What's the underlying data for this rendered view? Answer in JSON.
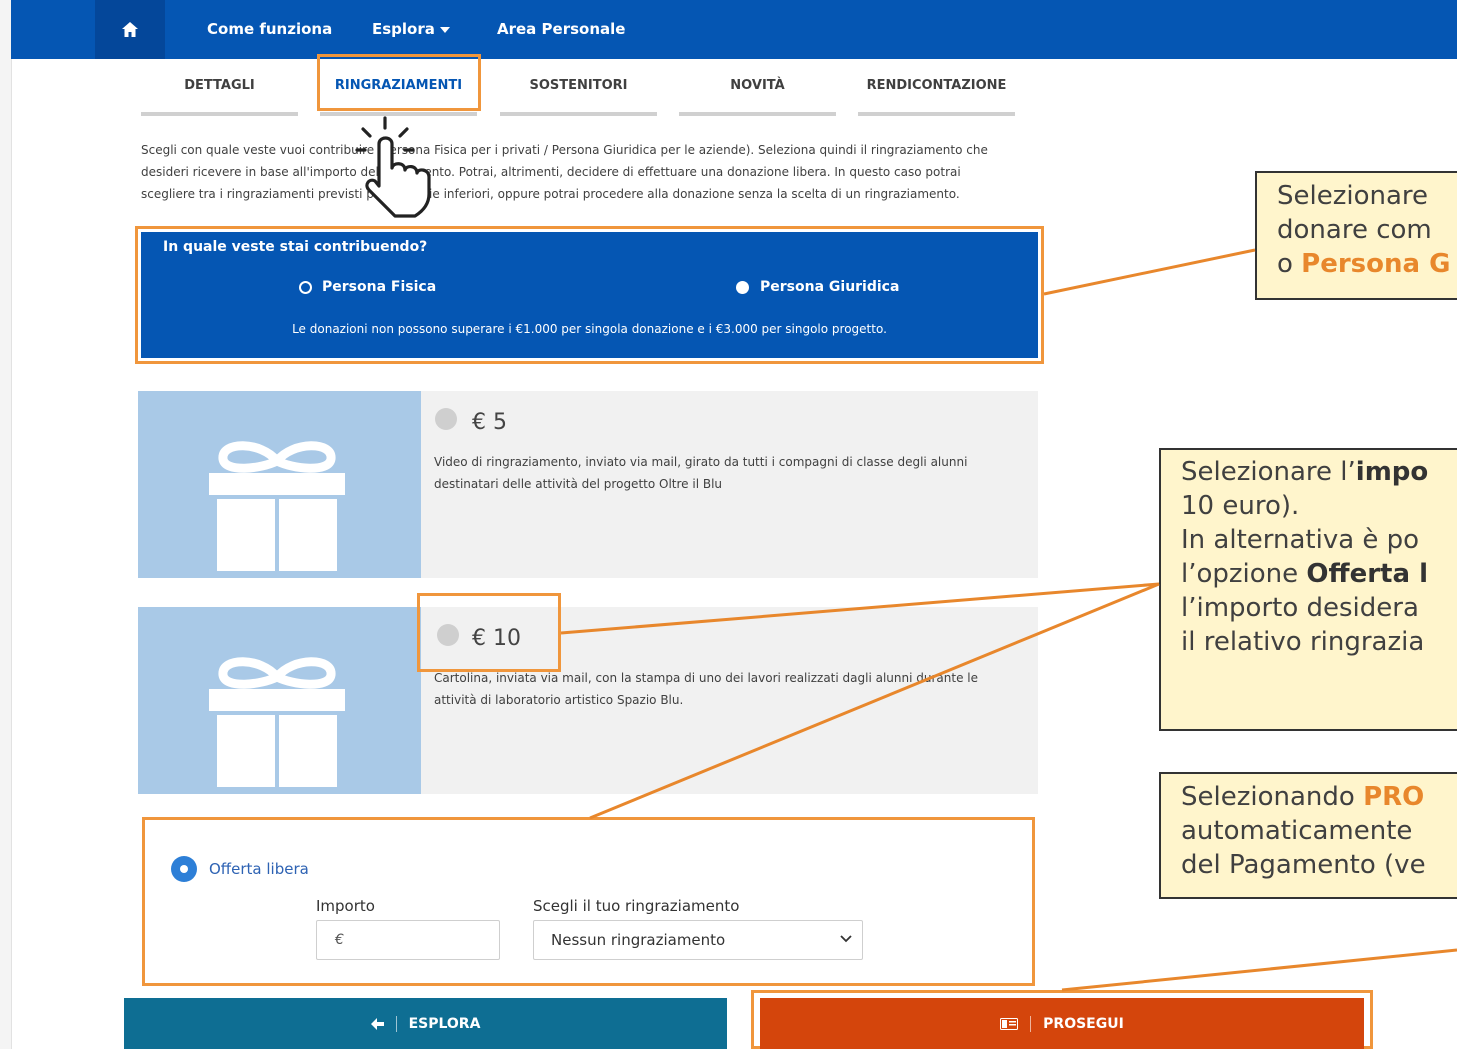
{
  "nav": {
    "home_icon": "home-icon",
    "links": [
      "Come funziona",
      "Esplora",
      "Area Personale"
    ]
  },
  "tabs": [
    "DETTAGLI",
    "RINGRAZIAMENTI",
    "SOSTENITORI",
    "NOVITÀ",
    "RENDICONTAZIONE"
  ],
  "intro": {
    "line1": "Scegli con quale veste vuoi contribuire (Persona Fisica per i privati / Persona Giuridica per le aziende). Seleziona quindi il ringraziamento che",
    "line2": "desideri ricevere in base all'importo del pagamento. Potrai, altrimenti, decidere di effettuare una donazione libera. In questo caso potrai",
    "line3": "scegliere tra i ringraziamenti previsti per le soglie inferiori, oppure potrai procedere alla donazione senza la scelta di un ringraziamento."
  },
  "contributor": {
    "title": "In quale veste stai contribuendo?",
    "option_fisica": "Persona Fisica",
    "option_giuridica": "Persona Giuridica",
    "note": "Le donazioni non possono superare i €1.000 per singola donazione e i €3.000 per singolo progetto."
  },
  "rewards": [
    {
      "price": "€ 5",
      "line1": "Video di ringraziamento, inviato via mail, girato da tutti i compagni di classe degli alunni",
      "line2": "destinatari delle attività del progetto Oltre il Blu"
    },
    {
      "price": "€ 10",
      "line1": "Cartolina, inviata via mail, con la stampa di uno dei lavori realizzati dagli alunni durante le",
      "line2": "attività di laboratorio artistico Spazio Blu."
    }
  ],
  "offerta": {
    "label": "Offerta libera",
    "importo_label": "Importo",
    "importo_placeholder": "€",
    "ringraziamento_label": "Scegli il tuo ringraziamento",
    "ringraziamento_value": "Nessun ringraziamento"
  },
  "buttons": {
    "esplora": "ESPLORA",
    "prosegui": "PROSEGUI"
  },
  "callouts": {
    "c1": {
      "line1": "Selezionare",
      "line2": "donare com",
      "line3_pre": "o ",
      "line3_bold": "Persona G"
    },
    "c2": {
      "line1_pre": "Selezionare l’",
      "line1_bold": "impo",
      "line2": "10 euro).",
      "line3": "In alternativa è po",
      "line4_pre": "l’opzione ",
      "line4_bold": "Offerta l",
      "line5": "l’importo desidera",
      "line6": "il relativo ringrazia"
    },
    "c3": {
      "line1_pre": "Selezionando ",
      "line1_bold": "PRO",
      "line2": "automaticamente",
      "line3": "del Pagamento (ve"
    }
  },
  "colors": {
    "nav_blue": "#0556b3",
    "highlight_orange": "#f0963c",
    "callout_bg": "#fff5cc",
    "prosegui_red": "#d4450c",
    "esplora_teal": "#0e6e93"
  }
}
